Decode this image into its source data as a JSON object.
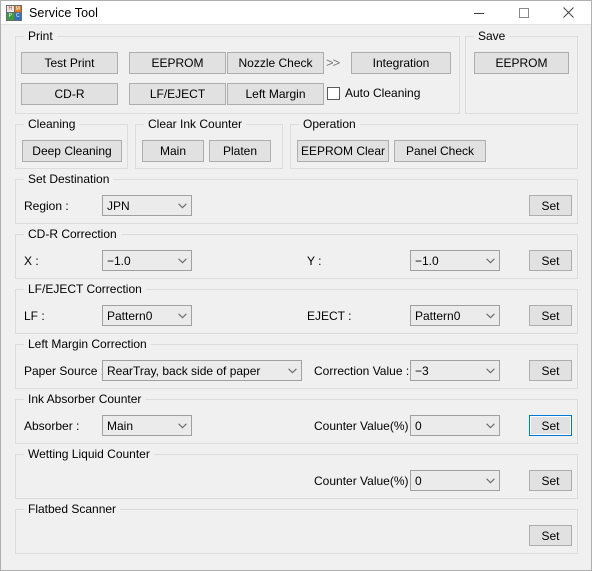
{
  "window": {
    "title": "Service Tool",
    "icon": "app-icon",
    "icon_letters": [
      "H",
      "M",
      "P",
      "C"
    ],
    "controls": {
      "minimize": "minimize-icon",
      "maximize": "maximize-icon",
      "close": "close-icon"
    }
  },
  "groups": {
    "print": {
      "legend": "Print",
      "buttons": [
        {
          "label": "Test Print"
        },
        {
          "label": "EEPROM"
        },
        {
          "label": "Nozzle Check"
        },
        {
          "label": "CD-R"
        },
        {
          "label": "LF/EJECT"
        },
        {
          "label": "Left Margin"
        }
      ],
      "chevron": ">>",
      "integration_label": "Integration",
      "auto_cleaning_label": "Auto Cleaning",
      "auto_cleaning_checked": false
    },
    "save": {
      "legend": "Save",
      "eeprom_label": "EEPROM"
    },
    "cleaning": {
      "legend": "Cleaning",
      "deep_cleaning_label": "Deep Cleaning"
    },
    "clear_ink_counter": {
      "legend": "Clear Ink Counter",
      "main_label": "Main",
      "platen_label": "Platen"
    },
    "operation": {
      "legend": "Operation",
      "eeprom_clear_label": "EEPROM Clear",
      "panel_check_label": "Panel Check"
    },
    "set_destination": {
      "legend": "Set Destination",
      "region_label": "Region :",
      "region_value": "JPN",
      "set_label": "Set"
    },
    "cdr_correction": {
      "legend": "CD-R Correction",
      "x_label": "X :",
      "x_value": "−1.0",
      "y_label": "Y :",
      "y_value": "−1.0",
      "set_label": "Set"
    },
    "lf_eject_correction": {
      "legend": "LF/EJECT Correction",
      "lf_label": "LF :",
      "lf_value": "Pattern0",
      "eject_label": "EJECT :",
      "eject_value": "Pattern0",
      "set_label": "Set"
    },
    "left_margin_correction": {
      "legend": "Left Margin Correction",
      "paper_source_label": "Paper Source :",
      "paper_source_value": "RearTray, back side of paper",
      "correction_value_label": "Correction Value :",
      "correction_value": "−3",
      "set_label": "Set"
    },
    "ink_absorber_counter": {
      "legend": "Ink Absorber Counter",
      "absorber_label": "Absorber :",
      "absorber_value": "Main",
      "counter_label": "Counter Value(%) :",
      "counter_value": "0",
      "set_label": "Set"
    },
    "wetting_liquid_counter": {
      "legend": "Wetting Liquid Counter",
      "counter_label": "Counter Value(%) :",
      "counter_value": "0",
      "set_label": "Set"
    },
    "flatbed_scanner": {
      "legend": "Flatbed Scanner",
      "set_label": "Set"
    }
  },
  "colors": {
    "window_bg": "#f0f0f0",
    "titlebar_bg": "#ffffff",
    "button_face": "#e1e1e1",
    "button_border": "#adadad",
    "group_border": "#dcdcdc",
    "combo_bg": "#ebebeb",
    "combo_border": "#a0a0a0",
    "focus_blue": "#0078d7"
  }
}
